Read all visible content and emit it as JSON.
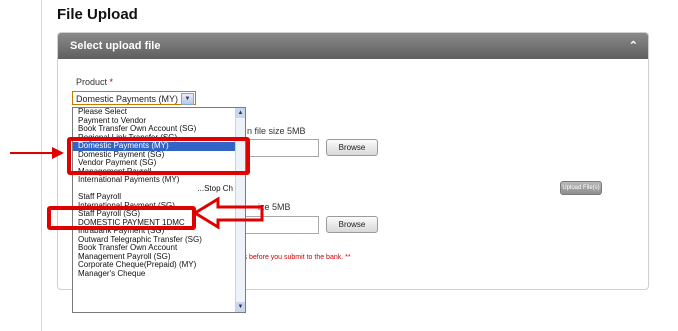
{
  "page": {
    "title": "File Upload"
  },
  "panel": {
    "header": "Select upload file",
    "collapse_icon": "chevron-up-icon"
  },
  "form": {
    "product_label": "Product",
    "required_mark": "*",
    "product_selected": "Domestic Payments (MY)",
    "file_size_note_1": "n file size 5MB",
    "file_size_note_2": "ize 5MB",
    "browse_label": "Browse",
    "upload_label": "Upload File(s)",
    "warning": "ls before you submit to the bank. **"
  },
  "dropdown": {
    "items": [
      "Please Select",
      "Payment to Vendor",
      "Book Transfer Own Account (SG)",
      "Regional Link Transfer (SG)",
      "Domestic Payments (MY)",
      "Domestic Payment (SG)",
      "Vendor Payment (SG)",
      "Management Payroll",
      "International Payments (MY)",
      "...Stop Ch",
      "Staff Payroll",
      "International Payment (SG)",
      "Staff Payroll (SG)",
      "DOMESTIC PAYMENT 1DMC",
      "Intrabank Payment (SG)",
      "Outward Telegraphic Transfer (SG)",
      "Book Transfer Own Account",
      "Management Payroll (SG)",
      "Corporate Cheque(Prepaid) (MY)",
      "Manager's Cheque"
    ],
    "selected_index": 4
  },
  "colors": {
    "highlight": "#e10000",
    "selection": "#3165c5"
  }
}
